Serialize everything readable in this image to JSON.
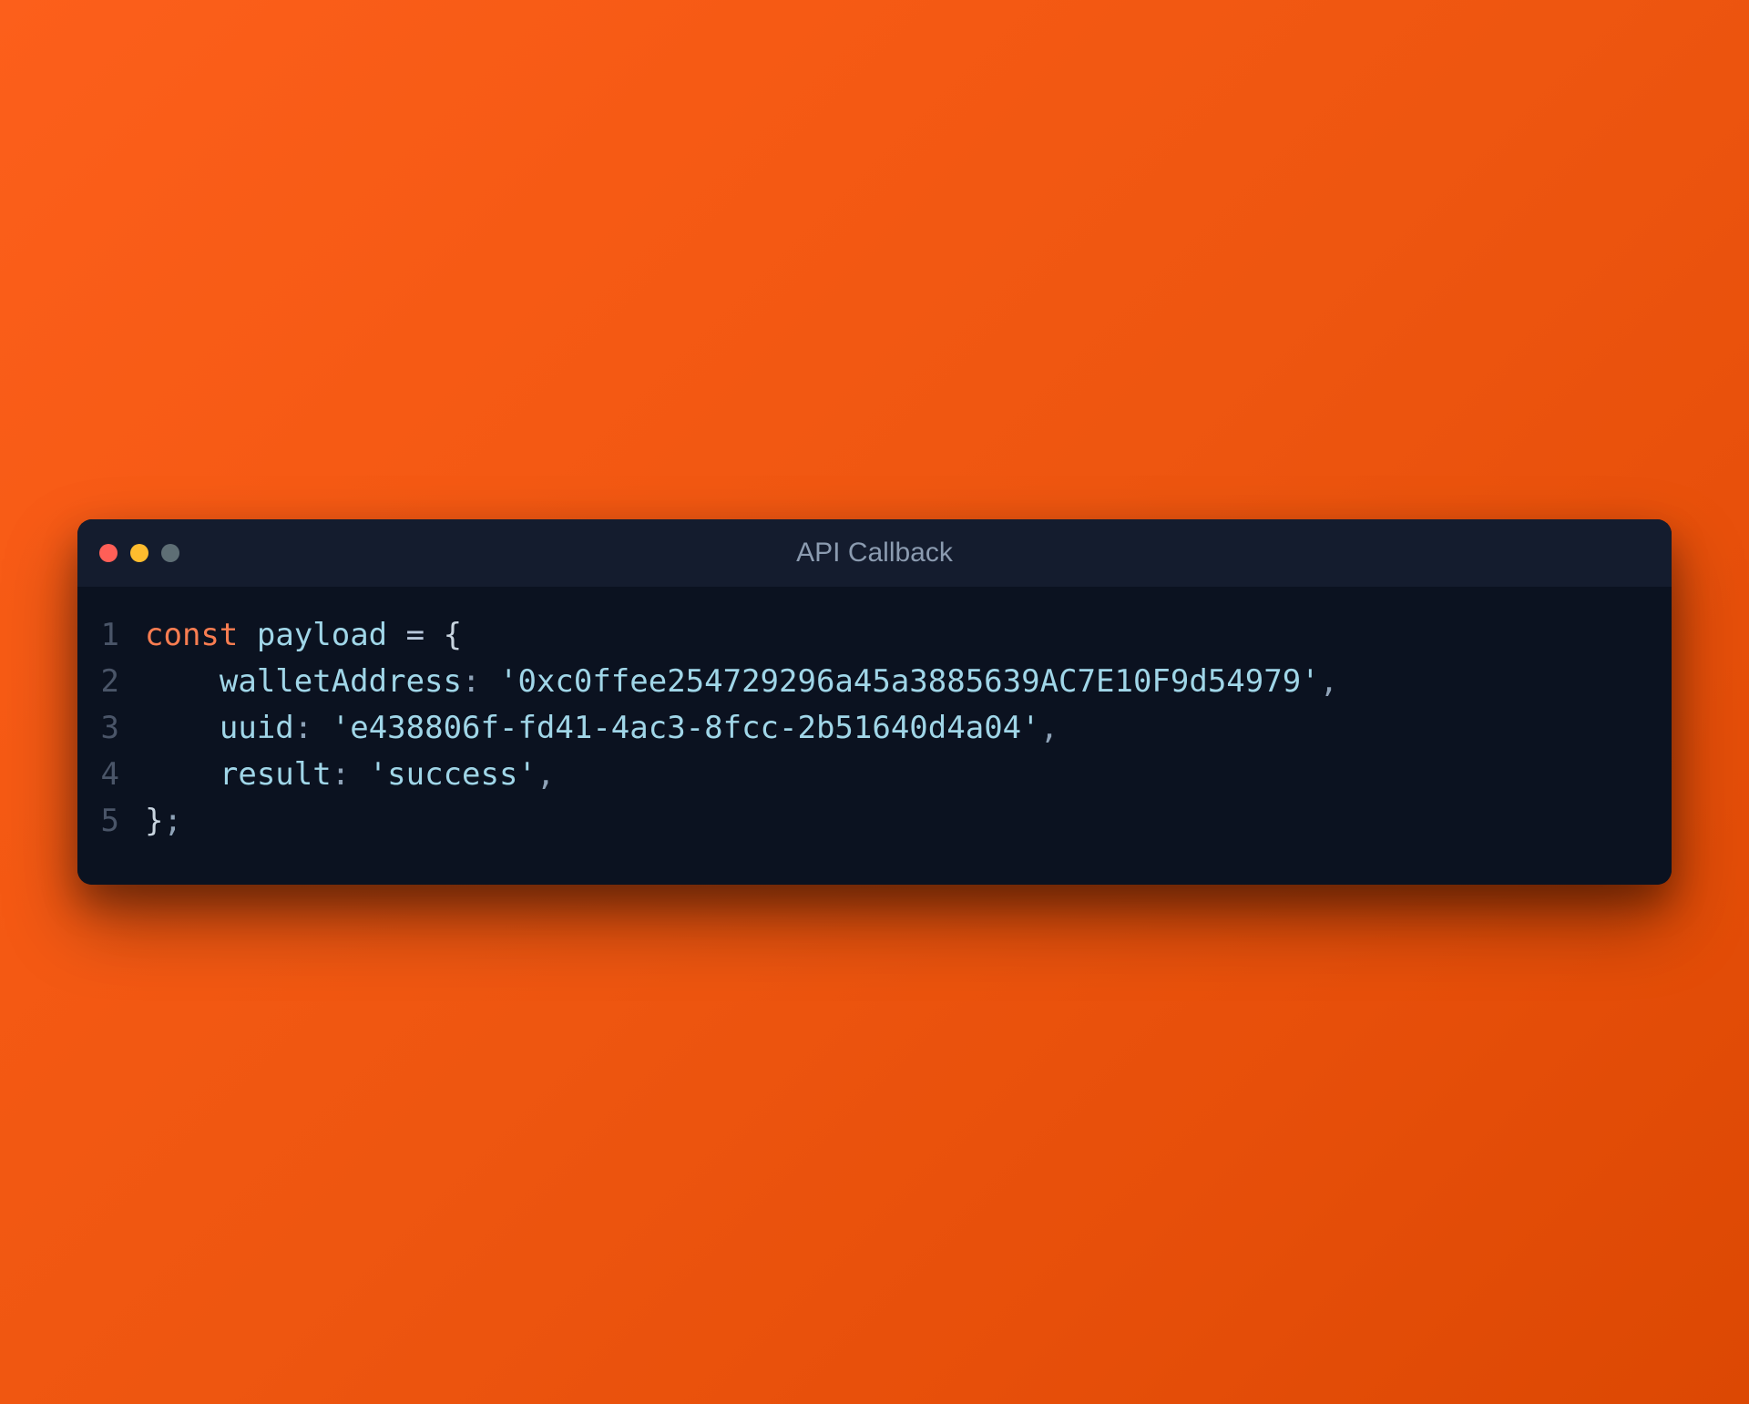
{
  "window": {
    "title": "API Callback"
  },
  "code": {
    "line1": {
      "keyword": "const",
      "variable": "payload",
      "operator": "=",
      "brace": "{"
    },
    "line2": {
      "indent": "    ",
      "property": "walletAddress",
      "colon": ":",
      "string": "'0xc0ffee254729296a45a3885639AC7E10F9d54979'",
      "comma": ","
    },
    "line3": {
      "indent": "    ",
      "property": "uuid",
      "colon": ":",
      "string": "'e438806f-fd41-4ac3-8fcc-2b51640d4a04'",
      "comma": ","
    },
    "line4": {
      "indent": "    ",
      "property": "result",
      "colon": ":",
      "string": "'success'",
      "comma": ","
    },
    "line5": {
      "brace": "}",
      "semicolon": ";"
    },
    "lineNumbers": [
      "1",
      "2",
      "3",
      "4",
      "5"
    ]
  }
}
